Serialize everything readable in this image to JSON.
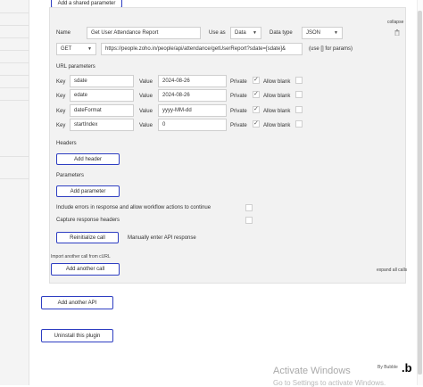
{
  "header": {
    "add_shared_parameter": "Add a shared parameter"
  },
  "call": {
    "collapse": "collapse",
    "name_label": "Name",
    "name_value": "Get User Attendance Report",
    "use_as_label": "Use as",
    "use_as_value": "Data",
    "data_type_label": "Data type",
    "data_type_value": "JSON",
    "method": "GET",
    "url": "https://people.zoho.in/people/api/attendance/getUserReport?sdate=[sdate]&",
    "url_hint": "(use [] for params)",
    "url_params_label": "URL parameters",
    "params": [
      {
        "key_label": "Key",
        "key": "sdate",
        "value_label": "Value",
        "value": "2024-08-26",
        "private_label": "Private",
        "private": true,
        "allow_blank_label": "Allow blank",
        "allow_blank": false
      },
      {
        "key_label": "Key",
        "key": "edate",
        "value_label": "Value",
        "value": "2024-08-26",
        "private_label": "Private",
        "private": true,
        "allow_blank_label": "Allow blank",
        "allow_blank": false
      },
      {
        "key_label": "Key",
        "key": "dateFormat",
        "value_label": "Value",
        "value": "yyyy-MM-dd",
        "private_label": "Private",
        "private": true,
        "allow_blank_label": "Allow blank",
        "allow_blank": false
      },
      {
        "key_label": "Key",
        "key": "startIndex",
        "value_label": "Value",
        "value": "0",
        "private_label": "Private",
        "private": true,
        "allow_blank_label": "Allow blank",
        "allow_blank": false
      }
    ],
    "headers_label": "Headers",
    "add_header": "Add header",
    "parameters_label": "Parameters",
    "add_parameter": "Add parameter",
    "include_errors": "Include errors in response and allow workflow actions to continue",
    "capture_headers": "Capture response headers",
    "reinitialize": "Reinitialize call",
    "manual_response": "Manually enter API response"
  },
  "footer": {
    "import_curl": "Import another call from cURL",
    "add_another_call": "Add another call",
    "expand_all": "expand all calls",
    "add_another_api": "Add another API",
    "uninstall": "Uninstall this plugin"
  },
  "watermark": {
    "line1": "Activate Windows",
    "line2": "Go to Settings to activate Windows."
  },
  "branding": {
    "by": "By Bubble",
    "logo": ".b"
  }
}
